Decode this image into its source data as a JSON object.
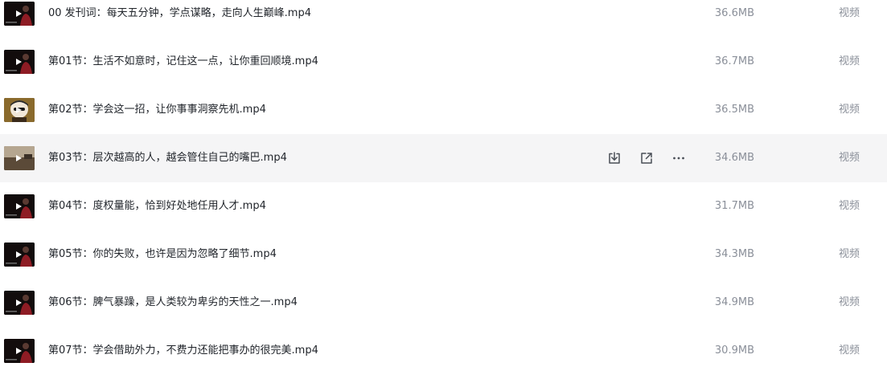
{
  "files": [
    {
      "name": "00 发刊词：每天五分钟，学点谋略，走向人生巅峰.mp4",
      "size": "36.6MB",
      "type": "视频",
      "thumb": "person-dark"
    },
    {
      "name": "第01节：生活不如意时，记住这一点，让你重回顺境.mp4",
      "size": "36.7MB",
      "type": "视频",
      "thumb": "person-dark"
    },
    {
      "name": "第02节：学会这一招，让你事事洞察先机.mp4",
      "size": "36.5MB",
      "type": "视频",
      "thumb": "cartoon-face"
    },
    {
      "name": "第03节：层次越高的人，越会管住自己的嘴巴.mp4",
      "size": "34.6MB",
      "type": "视频",
      "thumb": "landscape"
    },
    {
      "name": "第04节：度权量能，恰到好处地任用人才.mp4",
      "size": "31.7MB",
      "type": "视频",
      "thumb": "person-dark"
    },
    {
      "name": "第05节：你的失败，也许是因为忽略了细节.mp4",
      "size": "34.3MB",
      "type": "视频",
      "thumb": "person-dark"
    },
    {
      "name": "第06节：脾气暴躁，是人类较为卑劣的天性之一.mp4",
      "size": "34.9MB",
      "type": "视频",
      "thumb": "person-dark"
    },
    {
      "name": "第07节：学会借助外力，不费力还能把事办的很完美.mp4",
      "size": "30.9MB",
      "type": "视频",
      "thumb": "person-dark"
    }
  ],
  "hover_row": 3,
  "row_actions": [
    {
      "icon": "download-icon"
    },
    {
      "icon": "share-icon"
    },
    {
      "icon": "more-icon"
    }
  ],
  "colors": {
    "text": "#1f2329",
    "muted": "#8a8f99",
    "hover_bg": "#f5f5f6"
  }
}
